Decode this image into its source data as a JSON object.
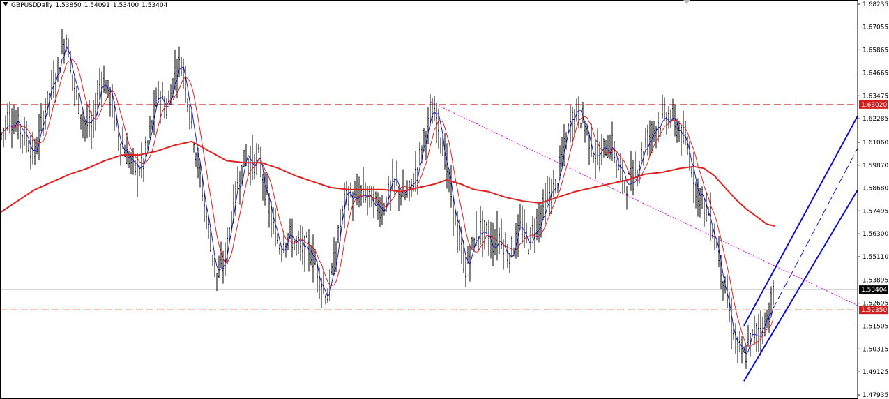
{
  "window": {
    "symbol": "GBPUSD",
    "timeframe": "Daily",
    "ohlc": [
      "1.53850",
      "1.54091",
      "1.53400",
      "1.53404"
    ]
  },
  "chart_data": {
    "type": "candlestick-ohlc",
    "ylim": [
      1.478,
      1.683
    ],
    "y_ticks": [
      "1.68235",
      "1.67055",
      "1.65865",
      "1.64665",
      "1.63475",
      "1.62285",
      "1.61060",
      "1.59870",
      "1.58680",
      "1.57495",
      "1.56300",
      "1.55110",
      "1.53895",
      "1.52695",
      "1.51505",
      "1.50315",
      "1.49125",
      "1.47935"
    ],
    "horizontal_levels": [
      {
        "label": "1.63020",
        "value": 1.6302,
        "style": "dashed",
        "color": "#d21e1e"
      },
      {
        "label": "1.52350",
        "value": 1.5235,
        "style": "dashed",
        "color": "#d21e1e"
      }
    ],
    "current_price": {
      "label": "1.53404",
      "value": 1.53404,
      "color": "#000000"
    },
    "series": [
      {
        "role": "price-bars",
        "color": "#000000"
      },
      {
        "role": "fast-ma",
        "color": "#1f1fbf"
      },
      {
        "role": "medium-ma",
        "color": "#e02020"
      },
      {
        "role": "slow-ma",
        "color": "#e02020"
      }
    ],
    "price_path": [
      [
        0,
        1.612
      ],
      [
        12,
        1.625
      ],
      [
        25,
        1.619
      ],
      [
        38,
        1.613
      ],
      [
        50,
        1.604
      ],
      [
        65,
        1.628
      ],
      [
        80,
        1.644
      ],
      [
        95,
        1.666
      ],
      [
        108,
        1.637
      ],
      [
        120,
        1.622
      ],
      [
        132,
        1.616
      ],
      [
        145,
        1.645
      ],
      [
        158,
        1.635
      ],
      [
        170,
        1.614
      ],
      [
        182,
        1.604
      ],
      [
        195,
        1.596
      ],
      [
        205,
        1.598
      ],
      [
        215,
        1.615
      ],
      [
        228,
        1.637
      ],
      [
        240,
        1.627
      ],
      [
        252,
        1.649
      ],
      [
        262,
        1.652
      ],
      [
        272,
        1.628
      ],
      [
        282,
        1.604
      ],
      [
        292,
        1.581
      ],
      [
        302,
        1.559
      ],
      [
        312,
        1.54
      ],
      [
        322,
        1.548
      ],
      [
        332,
        1.571
      ],
      [
        342,
        1.59
      ],
      [
        352,
        1.603
      ],
      [
        362,
        1.6
      ],
      [
        372,
        1.602
      ],
      [
        382,
        1.583
      ],
      [
        392,
        1.566
      ],
      [
        402,
        1.556
      ],
      [
        412,
        1.563
      ],
      [
        422,
        1.559
      ],
      [
        432,
        1.555
      ],
      [
        442,
        1.556
      ],
      [
        452,
        1.548
      ],
      [
        462,
        1.537
      ],
      [
        470,
        1.53
      ],
      [
        478,
        1.545
      ],
      [
        488,
        1.568
      ],
      [
        498,
        1.585
      ],
      [
        508,
        1.58
      ],
      [
        518,
        1.585
      ],
      [
        528,
        1.583
      ],
      [
        538,
        1.579
      ],
      [
        548,
        1.576
      ],
      [
        558,
        1.584
      ],
      [
        568,
        1.59
      ],
      [
        578,
        1.582
      ],
      [
        588,
        1.585
      ],
      [
        598,
        1.596
      ],
      [
        608,
        1.612
      ],
      [
        618,
        1.624
      ],
      [
        628,
        1.622
      ],
      [
        638,
        1.604
      ],
      [
        648,
        1.581
      ],
      [
        658,
        1.56
      ],
      [
        668,
        1.545
      ],
      [
        678,
        1.557
      ],
      [
        688,
        1.566
      ],
      [
        698,
        1.563
      ],
      [
        708,
        1.558
      ],
      [
        718,
        1.563
      ],
      [
        728,
        1.552
      ],
      [
        738,
        1.557
      ],
      [
        748,
        1.567
      ],
      [
        758,
        1.558
      ],
      [
        768,
        1.568
      ],
      [
        778,
        1.575
      ],
      [
        788,
        1.583
      ],
      [
        798,
        1.588
      ],
      [
        808,
        1.606
      ],
      [
        818,
        1.62
      ],
      [
        828,
        1.627
      ],
      [
        838,
        1.621
      ],
      [
        848,
        1.609
      ],
      [
        858,
        1.602
      ],
      [
        868,
        1.608
      ],
      [
        878,
        1.609
      ],
      [
        888,
        1.596
      ],
      [
        898,
        1.589
      ],
      [
        908,
        1.592
      ],
      [
        918,
        1.602
      ],
      [
        928,
        1.612
      ],
      [
        938,
        1.618
      ],
      [
        948,
        1.622
      ],
      [
        958,
        1.625
      ],
      [
        968,
        1.621
      ],
      [
        978,
        1.613
      ],
      [
        988,
        1.606
      ],
      [
        998,
        1.588
      ],
      [
        1008,
        1.58
      ],
      [
        1018,
        1.572
      ],
      [
        1028,
        1.558
      ],
      [
        1038,
        1.539
      ],
      [
        1048,
        1.518
      ],
      [
        1058,
        1.504
      ],
      [
        1068,
        1.498
      ],
      [
        1075,
        1.507
      ],
      [
        1082,
        1.511
      ],
      [
        1090,
        1.514
      ],
      [
        1098,
        1.516
      ],
      [
        1104,
        1.524
      ],
      [
        1110,
        1.534
      ]
    ],
    "slow_ma_path": [
      [
        0,
        1.574
      ],
      [
        25,
        1.58
      ],
      [
        50,
        1.586
      ],
      [
        75,
        1.59
      ],
      [
        100,
        1.594
      ],
      [
        125,
        1.597
      ],
      [
        150,
        1.601
      ],
      [
        175,
        1.604
      ],
      [
        200,
        1.604
      ],
      [
        225,
        1.606
      ],
      [
        250,
        1.609
      ],
      [
        275,
        1.611
      ],
      [
        300,
        1.606
      ],
      [
        325,
        1.601
      ],
      [
        350,
        1.6
      ],
      [
        375,
        1.6
      ],
      [
        400,
        1.597
      ],
      [
        425,
        1.593
      ],
      [
        450,
        1.59
      ],
      [
        475,
        1.587
      ],
      [
        500,
        1.586
      ],
      [
        525,
        1.586
      ],
      [
        550,
        1.586
      ],
      [
        575,
        1.585
      ],
      [
        600,
        1.587
      ],
      [
        625,
        1.589
      ],
      [
        640,
        1.591
      ],
      [
        660,
        1.589
      ],
      [
        680,
        1.586
      ],
      [
        700,
        1.585
      ],
      [
        725,
        1.582
      ],
      [
        750,
        1.58
      ],
      [
        775,
        1.579
      ],
      [
        800,
        1.582
      ],
      [
        825,
        1.585
      ],
      [
        850,
        1.587
      ],
      [
        875,
        1.589
      ],
      [
        900,
        1.591
      ],
      [
        925,
        1.594
      ],
      [
        950,
        1.595
      ],
      [
        975,
        1.597
      ],
      [
        995,
        1.598
      ],
      [
        1010,
        1.597
      ],
      [
        1025,
        1.593
      ],
      [
        1040,
        1.587
      ],
      [
        1055,
        1.581
      ],
      [
        1070,
        1.576
      ],
      [
        1085,
        1.572
      ],
      [
        1100,
        1.568
      ],
      [
        1112,
        1.567
      ]
    ]
  },
  "channel": {
    "color": "#0f0fc8",
    "label": "up-channel"
  },
  "trendline": {
    "color": "#e600e6",
    "label": "descending-trendline"
  }
}
